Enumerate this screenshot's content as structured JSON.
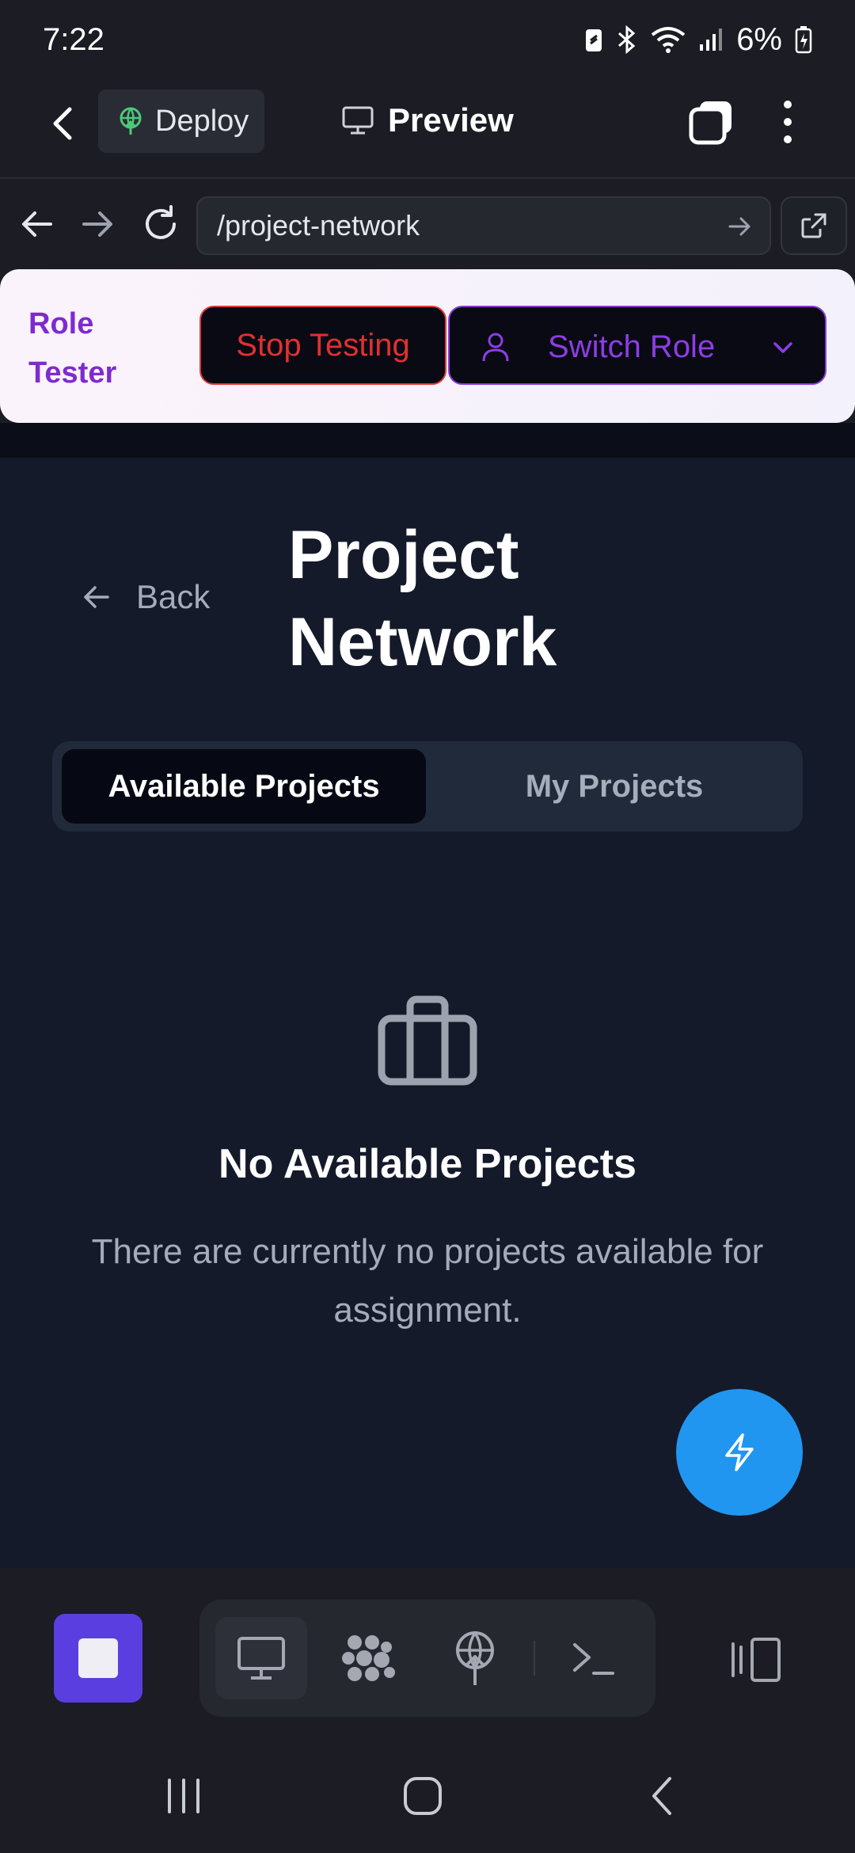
{
  "status_bar": {
    "time": "7:22",
    "battery": "6%",
    "icons": [
      "battery-saver-icon",
      "bluetooth-icon",
      "wifi-icon",
      "signal-icon",
      "battery-charging-icon"
    ]
  },
  "app_bar": {
    "deploy_label": "Deploy",
    "preview_label": "Preview"
  },
  "url_bar": {
    "url": "/project-network"
  },
  "role_tester": {
    "title": "Role Tester",
    "stop_label": "Stop Testing",
    "switch_label": "Switch Role",
    "colors": {
      "title": "#7d2bd0",
      "stop": "#e13030",
      "switch": "#8d3de4"
    }
  },
  "page": {
    "back_label": "Back",
    "title": "Project Network",
    "tabs": [
      {
        "label": "Available Projects",
        "active": true
      },
      {
        "label": "My Projects",
        "active": false
      }
    ],
    "empty_state": {
      "title": "No Available Projects",
      "description": "There are currently no projects available for assignment."
    }
  },
  "toolbar": {
    "tools": [
      "preview-monitor-icon",
      "workspace-grid-icon",
      "deploy-icon",
      "terminal-icon"
    ],
    "active_tool": "preview-monitor-icon",
    "accent": "#5a3ee0"
  },
  "fab": {
    "icon": "lightning-icon",
    "color": "#2196f0"
  }
}
